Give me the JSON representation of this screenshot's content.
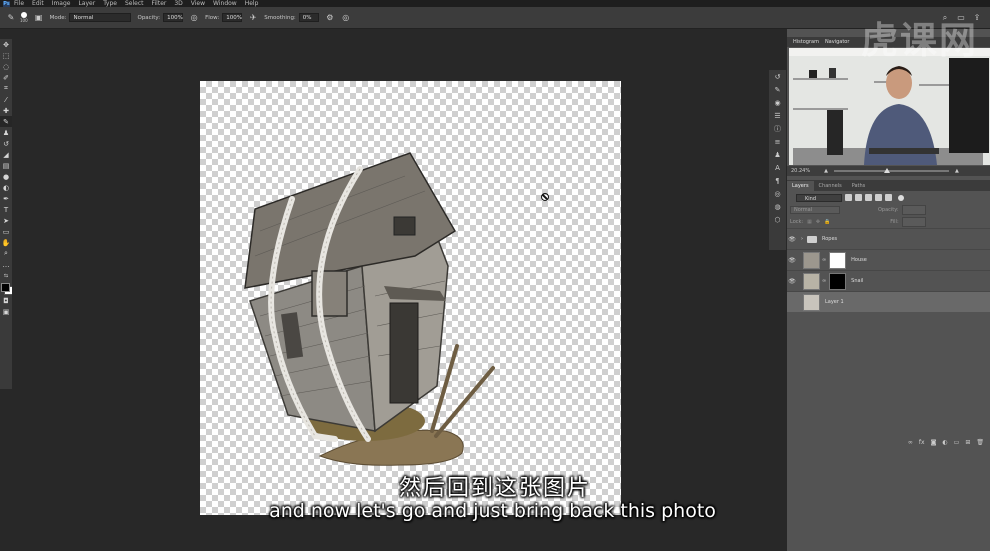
{
  "menu": {
    "logo": "Ps",
    "items": [
      "File",
      "Edit",
      "Image",
      "Layer",
      "Type",
      "Select",
      "Filter",
      "3D",
      "View",
      "Window",
      "Help"
    ]
  },
  "options": {
    "brush_size": "100",
    "mode_label": "Mode:",
    "mode_value": "Normal",
    "opacity_label": "Opacity:",
    "opacity_value": "100%",
    "flow_label": "Flow:",
    "flow_value": "100%",
    "smoothing_label": "Smoothing:",
    "smoothing_value": "0%"
  },
  "navigator": {
    "tabs": [
      "Histogram",
      "Navigator"
    ],
    "zoom": "20.24%"
  },
  "layers": {
    "tabs": [
      "Layers",
      "Channels",
      "Paths"
    ],
    "kind_label": "Kind",
    "blend_mode": "Normal",
    "opacity_label": "Opacity:",
    "lock_label": "Lock:",
    "fill_label": "Fill:",
    "items": [
      {
        "name": "Ropes",
        "type": "group"
      },
      {
        "name": "House",
        "type": "layer"
      },
      {
        "name": "Snail",
        "type": "layer"
      },
      {
        "name": "Layer 1",
        "type": "layer"
      }
    ]
  },
  "subtitles": {
    "chinese": "然后回到这张图片",
    "english": "and now let's go and just bring back this photo"
  },
  "watermark": "虎课网",
  "colors": {
    "accent": "#31a8ff",
    "panel_bg": "#535353",
    "canvas_bg": "#282828"
  }
}
